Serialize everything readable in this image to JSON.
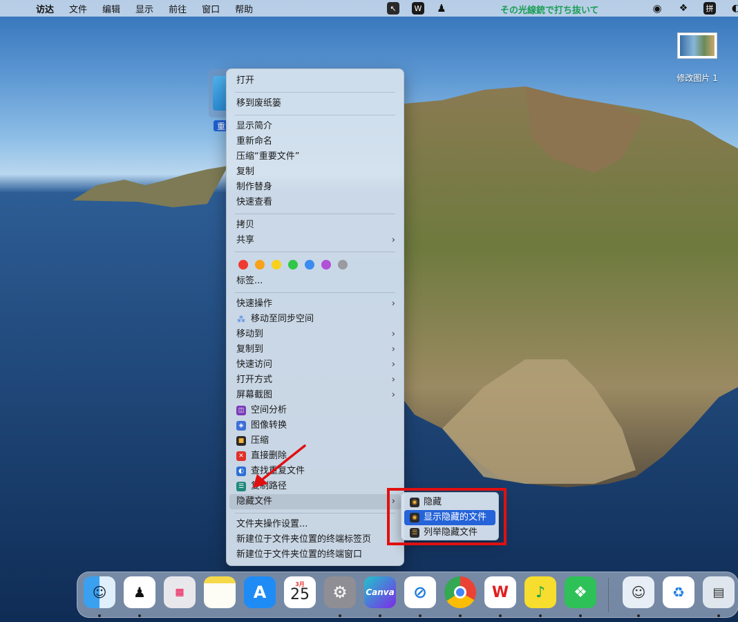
{
  "menubar": {
    "app_name": "访达",
    "items": [
      "文件",
      "编辑",
      "显示",
      "前往",
      "窗口",
      "帮助"
    ],
    "status_text": "その光線銃で打ち抜いて",
    "ime_label": "拼"
  },
  "desktop": {
    "screenshot_label": "修改图片 1",
    "folder_label": "重"
  },
  "context_menu": {
    "open": "打开",
    "trash": "移到废纸篓",
    "get_info": "显示简介",
    "rename": "重新命名",
    "compress": "压缩“重要文件”",
    "duplicate": "复制",
    "make_alias": "制作替身",
    "quick_look": "快速查看",
    "copy": "拷贝",
    "share": "共享",
    "tags_label": "标签...",
    "tag_colors": [
      "#f03a30",
      "#f7a21a",
      "#f7d01c",
      "#30c748",
      "#3a8cf0",
      "#b250d8",
      "#9a9aa0"
    ],
    "quick_actions": "快速操作",
    "move_to_sync": "移动至同步空间",
    "move_to": "移动到",
    "copy_to": "复制到",
    "quick_access": "快速访问",
    "open_with": "打开方式",
    "screenshot": "屏幕截图",
    "space_analysis": "空间分析",
    "image_convert": "图像转换",
    "compress2": "压缩",
    "delete_direct": "直接删除",
    "find_duplicates": "查找重复文件",
    "copy_path": "复制路径",
    "hide_files": "隐藏文件",
    "folder_settings": "文件夹操作设置...",
    "new_terminal_tab": "新建位于文件夹位置的终端标签页",
    "new_terminal_window": "新建位于文件夹位置的终端窗口"
  },
  "submenu": {
    "hide": "隐藏",
    "show_hidden": "显示隐藏的文件",
    "list_hidden": "列举隐藏文件"
  },
  "dock": {
    "calendar_month": "3月",
    "calendar_day": "25",
    "canva_label": "Canva",
    "apps": [
      "finder-icon",
      "qq-icon",
      "launchpad-icon",
      "notes-icon",
      "app-store-icon",
      "calendar-icon",
      "system-settings-icon",
      "canva-icon",
      "safari-icon",
      "chrome-icon",
      "wps-icon",
      "qq-music-icon",
      "wechat-icon",
      "user-app-icon",
      "uninstall-icon",
      "preview-icon"
    ]
  }
}
